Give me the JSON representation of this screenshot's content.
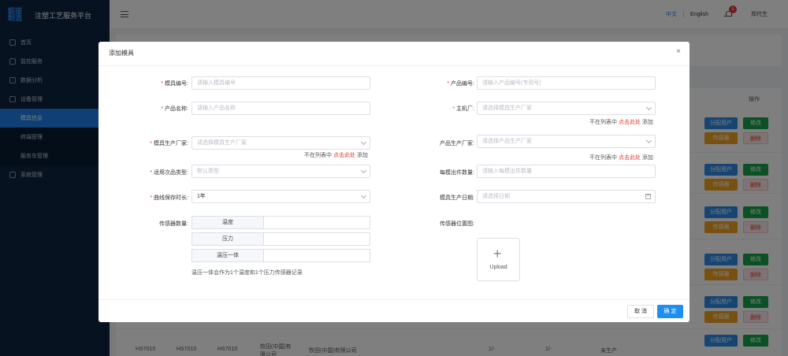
{
  "app": {
    "logo_line1": "韶拔",
    "logo_line2": "制造",
    "title": "注塑工艺服务平台"
  },
  "sidebar": {
    "items": [
      {
        "label": "首页"
      },
      {
        "label": "监控服务"
      },
      {
        "label": "数据分析"
      },
      {
        "label": "设备管理"
      },
      {
        "label": "模具信息"
      },
      {
        "label": "终端管理"
      },
      {
        "label": "服务车管理"
      },
      {
        "label": "系统管理"
      }
    ]
  },
  "header": {
    "lang_zh": "中文",
    "lang_en": "English",
    "notif_count": "1",
    "user": "郑代生"
  },
  "bg_table": {
    "op_header": "操作",
    "assign": "分配用户",
    "edit": "修改",
    "sensor": "传感器",
    "delete": "删除",
    "row_cells": [
      "HS7010",
      "HS7010",
      "HS7010",
      "牧田(中国)有限公司",
      "牧田(中国)有限公司",
      "1/-",
      "1/-",
      "未生产"
    ]
  },
  "modal": {
    "title": "添加模具",
    "close": "×",
    "fields": {
      "mold_no": {
        "label": "模具编号:",
        "placeholder": "请输入模具编号"
      },
      "product_no": {
        "label": "产品编号:",
        "placeholder": "请输入产品编号(专用号)"
      },
      "product_name": {
        "label": "产品名称:",
        "placeholder": "请输入产品名称"
      },
      "oem": {
        "label": "主机厂:",
        "placeholder": "请选择模具生产厂家"
      },
      "mold_maker": {
        "label": "模具生产厂家:",
        "placeholder": "请选择模具生产厂家"
      },
      "product_maker": {
        "label": "产品生产厂家:",
        "placeholder": "请选择产品生产厂家"
      },
      "defect_type": {
        "label": "适用次品类型:",
        "placeholder": "默认类型"
      },
      "cavity_qty": {
        "label": "每模出件数量:",
        "placeholder": "请输入每模出件数量"
      },
      "curve_retention": {
        "label": "曲线保存时长:",
        "value": "1年"
      },
      "mold_date": {
        "label": "模具生产日期:",
        "placeholder": "请选择日期"
      },
      "sensor_qty": {
        "label": "传感器数量:"
      },
      "sensor_pic": {
        "label": "传感器位置图:"
      }
    },
    "not_in_list": {
      "prefix": "不在列表中",
      "link": "点击此处",
      "suffix": "添加"
    },
    "sensor_types": [
      "温度",
      "压力",
      "温压一体"
    ],
    "sensor_note": "温压一体会作为1个温度和1个压力传感器记录",
    "upload_label": "Upload",
    "cancel": "取 消",
    "ok": "确 定"
  }
}
